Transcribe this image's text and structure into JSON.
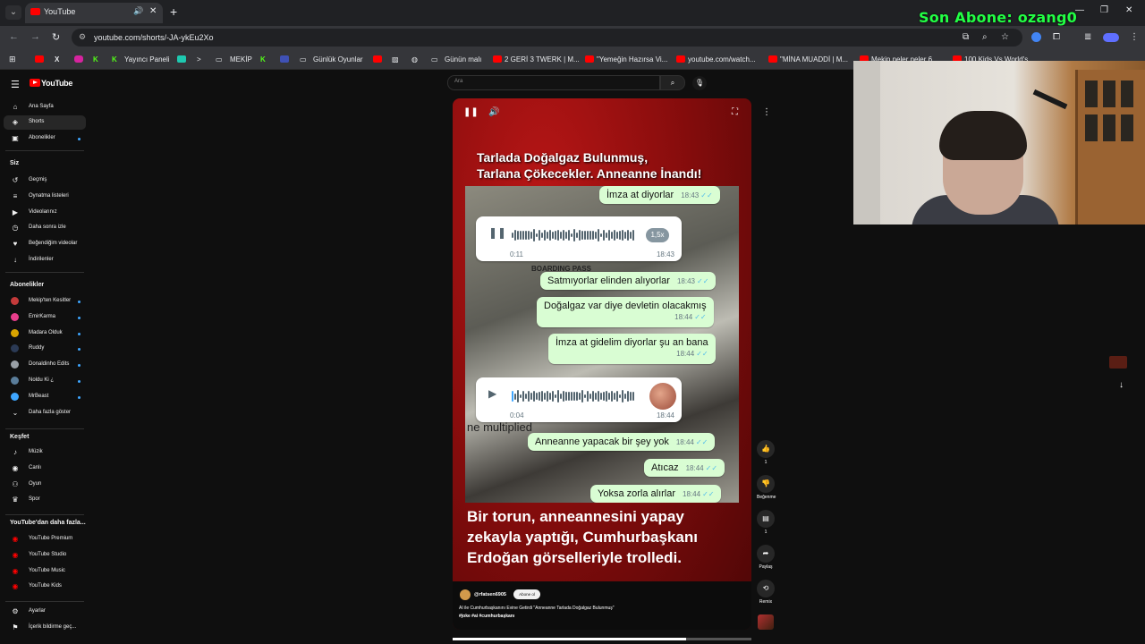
{
  "browser": {
    "tab_title": "YouTube",
    "url": "youtube.com/shorts/-JA-ykEu2Xo",
    "bookmarks": [
      {
        "label": "Yayıncı Paneli",
        "color": "#53fc18"
      },
      {
        "label": "MEKİP",
        "color": "#777777"
      },
      {
        "label": "Günlük Oyunlar",
        "color": "#777777"
      },
      {
        "label": "Günün malı",
        "color": "#777777"
      },
      {
        "label": "2 GERİ 3 TWERK | M...",
        "color": "#ff0000"
      },
      {
        "label": "\"Yemeğin Hazırsa Vi...",
        "color": "#ff0000"
      },
      {
        "label": "youtube.com/watch...",
        "color": "#ff0000"
      },
      {
        "label": "\"MİNA MUADDİ | M...",
        "color": "#ff0000"
      },
      {
        "label": "Mekip neler neler 6...",
        "color": "#ff0000"
      },
      {
        "label": "100 Kids Vs World's",
        "color": "#ff0000"
      }
    ]
  },
  "overlay": {
    "subscriber_text": "Son Abone: ozang0"
  },
  "youtube": {
    "logo_text": "YouTube",
    "search_placeholder": "Ara",
    "guide": {
      "main": [
        {
          "label": "Ana Sayfa",
          "icon": "home-icon",
          "glyph": "⌂",
          "active": false
        },
        {
          "label": "Shorts",
          "icon": "shorts-icon",
          "glyph": "◈",
          "active": true
        },
        {
          "label": "Abonelikler",
          "icon": "subscriptions-icon",
          "glyph": "▣",
          "active": false
        }
      ],
      "you_heading": "Siz",
      "you": [
        {
          "label": "Geçmiş",
          "icon": "history-icon",
          "glyph": "↺"
        },
        {
          "label": "Oynatma listeleri",
          "icon": "playlists-icon",
          "glyph": "≡"
        },
        {
          "label": "Videolarınız",
          "icon": "your-videos-icon",
          "glyph": "▶"
        },
        {
          "label": "Daha sonra izle",
          "icon": "watch-later-icon",
          "glyph": "◷"
        },
        {
          "label": "Beğendiğim videolar",
          "icon": "liked-icon",
          "glyph": "♥"
        },
        {
          "label": "İndirilenler",
          "icon": "downloads-icon",
          "glyph": "↓"
        }
      ],
      "subs_heading": "Abonelikler",
      "subs": [
        {
          "label": "Mekip'ten Kesitler",
          "color": "#c43a3a"
        },
        {
          "label": "EmirKarma",
          "color": "#e83e8c"
        },
        {
          "label": "Madara Olduk",
          "color": "#d9a400"
        },
        {
          "label": "Ruddy",
          "color": "#2b3a55"
        },
        {
          "label": "Donaldinho Edits",
          "color": "#9aa0a6"
        },
        {
          "label": "Noldu Ki ¿",
          "color": "#5a7d9a"
        },
        {
          "label": "MrBeast",
          "color": "#3ea6ff"
        }
      ],
      "show_more": "Daha fazla göster",
      "explore_heading": "Keşfet",
      "explore": [
        {
          "label": "Müzik",
          "icon": "music-icon",
          "glyph": "♪"
        },
        {
          "label": "Canlı",
          "icon": "live-icon",
          "glyph": "◉"
        },
        {
          "label": "Oyun",
          "icon": "gaming-icon",
          "glyph": "⚇"
        },
        {
          "label": "Spor",
          "icon": "sports-icon",
          "glyph": "♛"
        }
      ],
      "more_heading": "YouTube'dan daha fazla...",
      "more": [
        {
          "label": "YouTube Premium"
        },
        {
          "label": "YouTube Studio"
        },
        {
          "label": "YouTube Music"
        },
        {
          "label": "YouTube Kids"
        }
      ],
      "bottom": [
        {
          "label": "Ayarlar",
          "icon": "settings-icon",
          "glyph": "⚙"
        },
        {
          "label": "İçerik bildirme geç...",
          "icon": "flag-icon",
          "glyph": "⚑"
        }
      ]
    },
    "short": {
      "headline_1": "Tarlada Doğalgaz Bulunmuş,",
      "headline_2": "Tarlana Çökecekler. Anneanne İnandı!",
      "chat": {
        "m1": {
          "text": "İmza at diyorlar",
          "time": "18:43"
        },
        "voice1": {
          "duration": "0:11",
          "time": "18:43",
          "speed": "1,5x"
        },
        "m2": {
          "text": "Satmıyorlar elinden alıyorlar",
          "time": "18:43"
        },
        "m3": {
          "text": "Doğalgaz var diye devletin olacakmış",
          "time": "18:44"
        },
        "m4": {
          "text": "İmza at gidelim diyorlar şu an bana",
          "time": "18:44"
        },
        "voice2": {
          "duration": "0:04",
          "time": "18:44"
        },
        "m5": {
          "text": "Anneanne yapacak bir şey yok",
          "time": "18:44"
        },
        "m6": {
          "text": "Atıcaz",
          "time": "18:44"
        },
        "m7": {
          "text": "Yoksa zorla alırlar",
          "time": "18:44"
        },
        "bg_text_1": "BOARDING PASS",
        "bg_text_2": "ne multiplied"
      },
      "caption_1": "Bir torun, anneannesini yapay",
      "caption_2": "zekayla yaptığı, Cumhurbaşkanı",
      "caption_3": "Erdoğan görselleriyle trolledi.",
      "channel": "@rfatsen6905",
      "subscribe_label": "Abone ol",
      "description": "AI ile Cumhurbaşkanını Evine Getirdi \"Anneanne Tarlada Doğalgaz Bulunmuş\"",
      "hashtags": "#joke #ai #cumhurbaşkanı",
      "progress": 0.78
    },
    "actions": {
      "like_count": "1",
      "dislike_label": "Beğenme",
      "comment_count": "1",
      "share_label": "Paylaş",
      "remix_label": "Remix"
    }
  }
}
